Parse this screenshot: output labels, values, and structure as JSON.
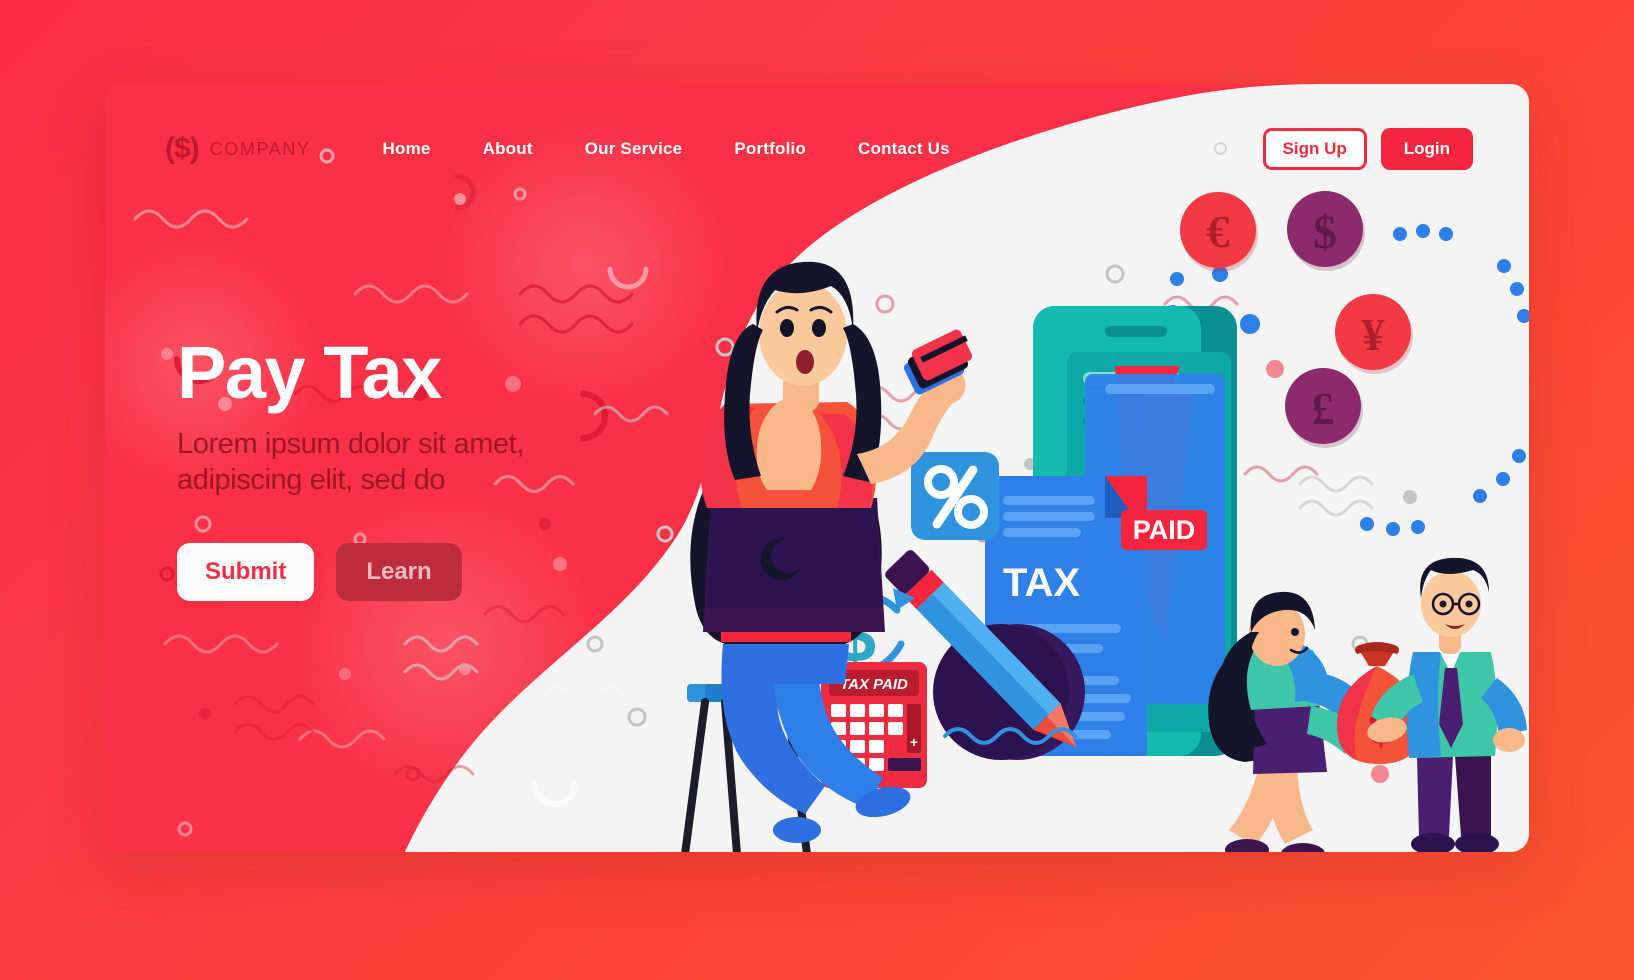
{
  "page": {
    "background_gradient_from": "#fa2c45",
    "background_gradient_to": "#fb5430",
    "card_red": "#f93146",
    "card_white": "#f4f4f4"
  },
  "nav": {
    "logo_mark": "($)",
    "logo_text": "COMPANY",
    "links": [
      {
        "label": "Home"
      },
      {
        "label": "About"
      },
      {
        "label": "Our Service"
      },
      {
        "label": "Portfolio"
      },
      {
        "label": "Contact Us"
      }
    ],
    "signup_label": "Sign Up",
    "login_label": "Login",
    "signup_color": "#ef2b41",
    "login_color": "#f4263f"
  },
  "hero": {
    "title": "Pay Tax",
    "subtitle": "Lorem ipsum dolor sit amet, adipiscing elit, sed do",
    "submit_label": "Submit",
    "learn_label": "Learn",
    "title_color": "#fdfdfd",
    "subtitle_color": "#9e1528"
  },
  "illustration": {
    "document": {
      "title": "TAX",
      "badge": "PAID",
      "paper_color": "#2f7fe8",
      "badge_color": "#f4253c",
      "fold_color": "#f4253c"
    },
    "phone": {
      "body_color": "#12b3ad",
      "screen_color": "#0fa7a7"
    },
    "calculator": {
      "display_text": "TAX PAID",
      "body_color": "#ee2c41",
      "display_color": "#b81c2e",
      "plus_key": "+",
      "equals_key": "="
    },
    "percent_badge": {
      "symbol": "%",
      "color": "#2f93e0"
    },
    "refresh_dollar": {
      "symbol": "$",
      "arrow_up_color": "#2f93e0",
      "arrow_down_color": "#f04a3c"
    },
    "money_bag": {
      "symbol": "$",
      "color": "#f4533a"
    },
    "coins": [
      {
        "symbol": "€",
        "name": "euro-coin",
        "color": "#f23a43",
        "glyph_color": "#b21e2b"
      },
      {
        "symbol": "$",
        "name": "dollar-coin",
        "color": "#8d2a6b",
        "glyph_color": "#5e1a4a"
      },
      {
        "symbol": "¥",
        "name": "yen-coin",
        "color": "#f23a43",
        "glyph_color": "#b21e2b"
      },
      {
        "symbol": "£",
        "name": "pound-coin",
        "color": "#8d2a6b",
        "glyph_color": "#5e1a4a"
      }
    ],
    "pencil": {
      "body_color": "#2f93e0",
      "tip_color": "#f04a3c",
      "eraser_color": "#3b1450"
    },
    "characters": [
      {
        "name": "woman-with-laptop",
        "holding": "credit-cards"
      },
      {
        "name": "woman-giving-money-bag"
      },
      {
        "name": "man-receiving-money-bag"
      }
    ]
  }
}
